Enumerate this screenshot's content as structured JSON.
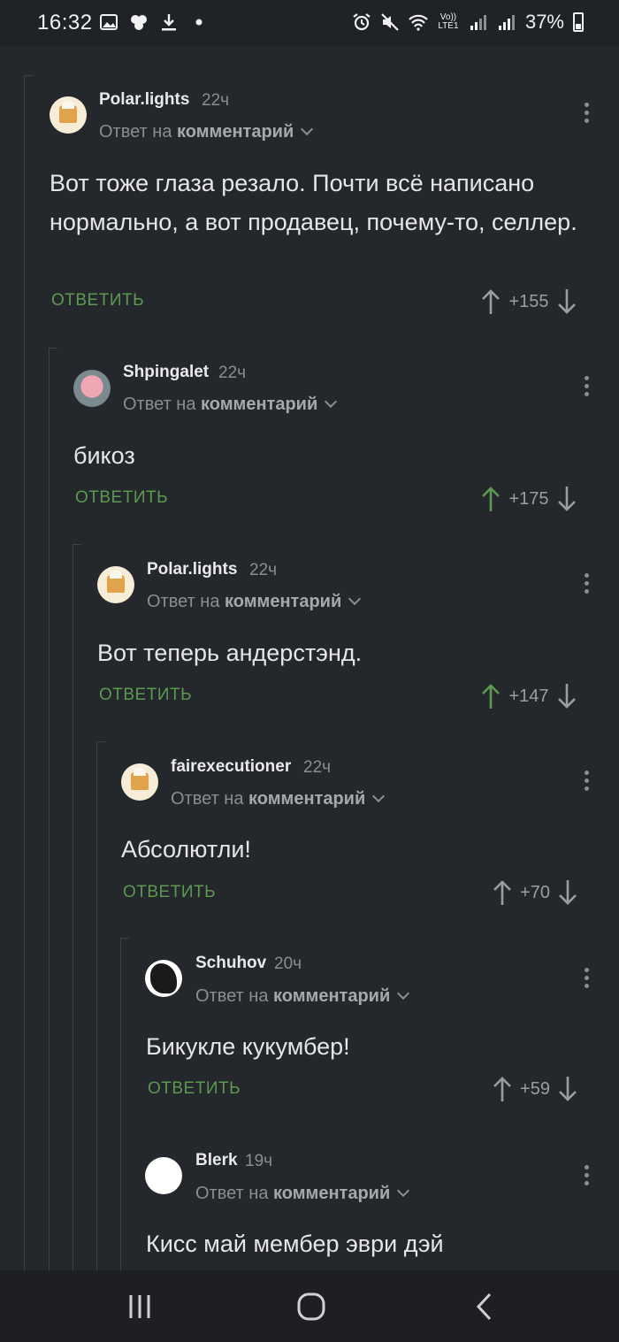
{
  "status_bar": {
    "time": "16:32",
    "battery": "37%",
    "network": "Vo)) LTE1"
  },
  "comments": [
    {
      "username": "Polar.lights",
      "time": "22ч",
      "reply_prefix": "Ответ на",
      "reply_target": "комментарий",
      "text": "Вот тоже глаза резало. Почти всё написано нормально, а вот продавец, почему-то, селлер.",
      "reply_label": "ОТВЕТИТЬ",
      "rating": "+155",
      "upvoted": false,
      "avatar_icon": "baker-avatar-icon"
    },
    {
      "username": "Shpingalet",
      "time": "22ч",
      "reply_prefix": "Ответ на",
      "reply_target": "комментарий",
      "text": "бикоз",
      "reply_label": "ОТВЕТИТЬ",
      "rating": "+175",
      "upvoted": true,
      "avatar_icon": "patrick-avatar-icon"
    },
    {
      "username": "Polar.lights",
      "time": "22ч",
      "reply_prefix": "Ответ на",
      "reply_target": "комментарий",
      "text": "Вот теперь андерстэнд.",
      "reply_label": "ОТВЕТИТЬ",
      "rating": "+147",
      "upvoted": true,
      "avatar_icon": "baker-avatar-icon"
    },
    {
      "username": "fairexecutioner",
      "time": "22ч",
      "reply_prefix": "Ответ на",
      "reply_target": "комментарий",
      "text": "Абсолютли!",
      "reply_label": "ОТВЕТИТЬ",
      "rating": "+70",
      "upvoted": false,
      "avatar_icon": "baker-avatar-icon"
    },
    {
      "username": "Schuhov",
      "time": "20ч",
      "reply_prefix": "Ответ на",
      "reply_target": "комментарий",
      "text": "Бикукле кукумбер!",
      "reply_label": "ОТВЕТИТЬ",
      "rating": "+59",
      "upvoted": false,
      "avatar_icon": "dark-figure-avatar-icon"
    },
    {
      "username": "Blerk",
      "time": "19ч",
      "reply_prefix": "Ответ на",
      "reply_target": "комментарий",
      "text": "Кисс май мембер эври дэй",
      "avatar_icon": "blank-avatar-icon"
    }
  ],
  "colors": {
    "background": "#24272b",
    "accent_green": "#5b9a4f",
    "muted": "#8a8e93"
  }
}
